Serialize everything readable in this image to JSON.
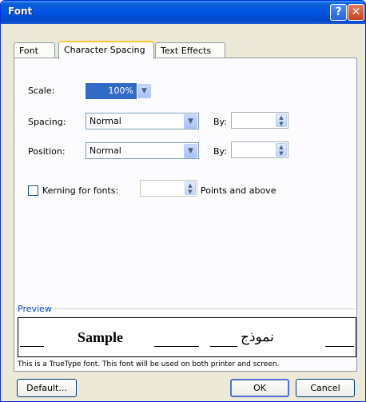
{
  "window": {
    "title": "Font",
    "help_glyph": "?",
    "close_glyph": "✕"
  },
  "tabs": [
    {
      "label": "Font",
      "selected": false
    },
    {
      "label": "Character Spacing",
      "selected": true
    },
    {
      "label": "Text Effects",
      "selected": false
    }
  ],
  "spacing_form": {
    "scale_label": "Scale:",
    "scale_value": "100%",
    "spacing_label": "Spacing:",
    "spacing_value": "Normal",
    "spacing_by_label": "By:",
    "spacing_by_value": "",
    "position_label": "Position:",
    "position_value": "Normal",
    "position_by_label": "By:",
    "position_by_value": "",
    "kerning_label": "Kerning for fonts:",
    "kerning_checked": false,
    "kerning_value": "",
    "kerning_suffix": "Points and above"
  },
  "preview": {
    "label": "Preview",
    "sample_text": "Sample",
    "arabic_sample": "نموذج",
    "note": "This is a TrueType font. This font will be used on both printer and screen."
  },
  "buttons": {
    "default_label": "Default...",
    "ok_label": "OK",
    "cancel_label": "Cancel"
  },
  "icons": {
    "dropdown_arrow": "▼",
    "spin_up": "▲",
    "spin_down": "▼"
  },
  "colors": {
    "titlebar_blue": "#0055e5",
    "selection_blue": "#316ac5",
    "preview_label_blue": "#0046d5",
    "tab_highlight": "#ffc83c"
  }
}
